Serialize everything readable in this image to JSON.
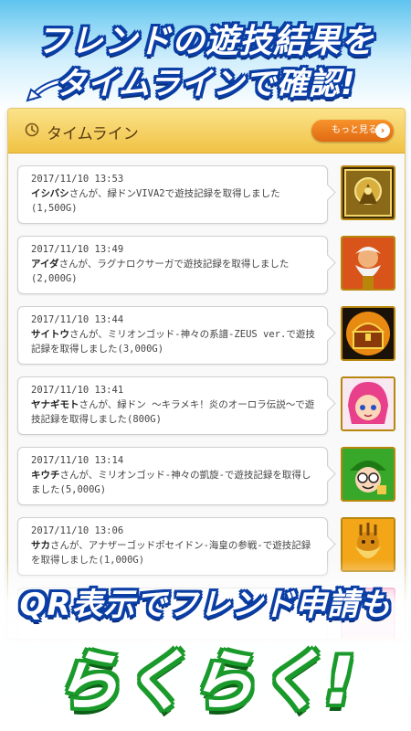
{
  "headline": {
    "line1": "フレンドの遊技結果を",
    "line2": "タイムラインで確認!"
  },
  "panel": {
    "title": "タイムライン",
    "more_label": "もっと見る",
    "more_icon": "chevron-right-icon",
    "clock_icon": "clock-icon"
  },
  "items": [
    {
      "timestamp": "2017/11/10 13:53",
      "name": "イシバシ",
      "text": "さんが、緑ドンVIVA2で遊技記録を取得しました(1,500G)",
      "thumb": "golden-crest"
    },
    {
      "timestamp": "2017/11/10 13:49",
      "name": "アイダ",
      "text": "さんが、ラグナロクサーガで遊技記録を取得しました(2,000G)",
      "thumb": "bearded-god"
    },
    {
      "timestamp": "2017/11/10 13:44",
      "name": "サイトウ",
      "text": "さんが、ミリオンゴッド-神々の系譜-ZEUS ver.で遊技記録を取得しました(3,000G)",
      "thumb": "treasure-chest"
    },
    {
      "timestamp": "2017/11/10 13:41",
      "name": "ヤナギモト",
      "text": "さんが、緑ドン ～キラメキ！炎のオーロラ伝説～で遊技記録を取得しました(800G)",
      "thumb": "pink-hair-girl"
    },
    {
      "timestamp": "2017/11/10 13:14",
      "name": "キウチ",
      "text": "さんが、ミリオンゴッド-神々の凱旋-で遊技記録を取得しました(5,000G)",
      "thumb": "green-hat-boy"
    },
    {
      "timestamp": "2017/11/10 13:06",
      "name": "サカ",
      "text": "さんが、アナザーゴッドポセイドン-海皇の参戦-で遊技記録を取得しました(1,000G)",
      "thumb": "golden-poseidon"
    }
  ],
  "bottom": {
    "line1": "QR表示でフレンド申請も",
    "line2": "らくらく!"
  },
  "colors": {
    "headline_outline": "#0a3ea5",
    "panel_header": "#f0c244",
    "more_button": "#e06a12",
    "bottom_outline": "#1a9a2a"
  }
}
